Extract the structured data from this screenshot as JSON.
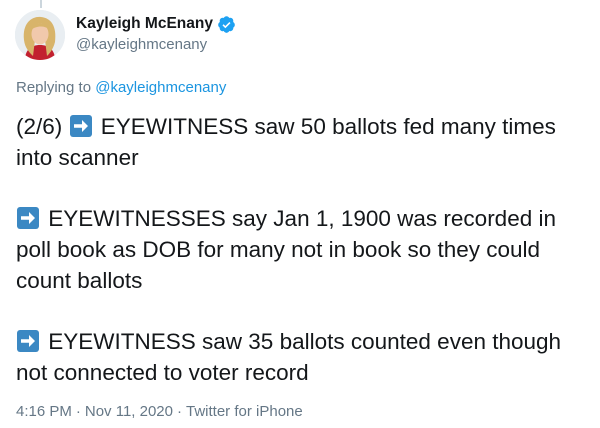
{
  "author": {
    "name": "Kayleigh McEnany",
    "handle": "@kayleighmcenany",
    "verified_icon": "verified-badge-icon"
  },
  "reply": {
    "prefix": "Replying to",
    "mention": "@kayleighmcenany"
  },
  "tweet": {
    "p1_prefix": "(2/6) ",
    "p1_text": " EYEWITNESS saw 50 ballots fed many times into scanner",
    "p2_text": " EYEWITNESSES say Jan 1, 1900 was recorded in poll book as DOB for many not in book so they could count ballots",
    "p3_text": " EYEWITNESS saw 35 ballots counted even though not connected to voter record",
    "arrow_icon": "right-arrow-emoji-icon"
  },
  "meta": {
    "time": "4:16 PM",
    "date": "Nov 11, 2020",
    "separator": "·",
    "source": "Twitter for iPhone"
  },
  "colors": {
    "text": "#14171a",
    "secondary": "#657786",
    "link": "#1b95e0",
    "verified": "#1da1f2",
    "arrow_emoji": "#3b88c3"
  }
}
